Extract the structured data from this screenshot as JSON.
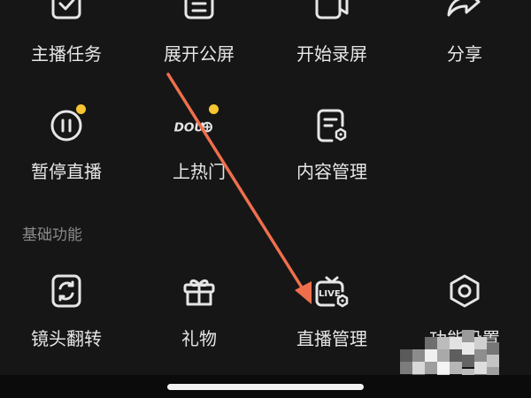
{
  "row1": [
    {
      "label": "主播任务",
      "icon": "task-check-icon"
    },
    {
      "label": "展开公屏",
      "icon": "list-icon"
    },
    {
      "label": "开始录屏",
      "icon": "video-camera-icon"
    },
    {
      "label": "分享",
      "icon": "share-arrow-icon"
    }
  ],
  "row2": [
    {
      "label": "暂停直播",
      "icon": "pause-circle-icon",
      "badge": true
    },
    {
      "label": "上热门",
      "icon": "dou-plus-icon",
      "icon_text": "DOU",
      "badge": true
    },
    {
      "label": "内容管理",
      "icon": "content-manage-icon"
    }
  ],
  "section": {
    "title": "基础功能"
  },
  "row3": [
    {
      "label": "镜头翻转",
      "icon": "camera-flip-icon"
    },
    {
      "label": "礼物",
      "icon": "gift-icon"
    },
    {
      "label": "直播管理",
      "icon": "live-tv-icon",
      "icon_text": "LIVE"
    },
    {
      "label": "功能设置",
      "icon": "settings-hexagon-icon"
    }
  ],
  "colors": {
    "background": "#161616",
    "text": "#e6e6e6",
    "badge": "#f7c531",
    "arrow": "#ef6f4d"
  }
}
